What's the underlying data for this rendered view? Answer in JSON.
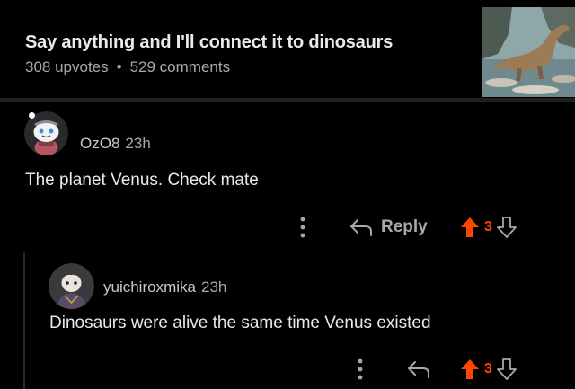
{
  "post": {
    "title": "Say anything and I'll connect it to dinosaurs",
    "upvotes": "308 upvotes",
    "separator": "•",
    "comments": "529 comments"
  },
  "comments": [
    {
      "username": "OzO8",
      "age": "23h",
      "body": "The planet Venus. Check mate",
      "reply_label": "Reply",
      "vote_count": "3"
    },
    {
      "username": "yuichiroxmika",
      "age": "23h",
      "body": "Dinosaurs were alive the same time Venus existed",
      "vote_count": "3"
    }
  ],
  "colors": {
    "background": "#000000",
    "upvote_active": "#ff4500",
    "muted_text": "#a6a9ab",
    "body_text": "#e8eaed"
  },
  "icons": {
    "more": "more-vertical-icon",
    "reply": "reply-arrow-icon",
    "upvote": "upvote-arrow-icon",
    "downvote": "downvote-arrow-icon"
  }
}
